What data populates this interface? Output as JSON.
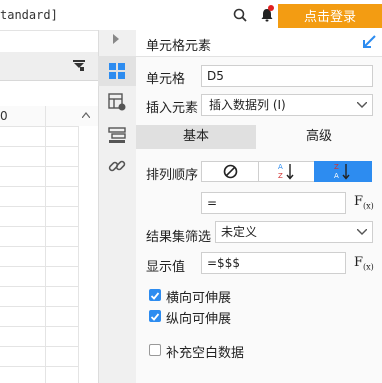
{
  "topbar": {
    "filename": "tandard]",
    "login_label": "点击登录"
  },
  "sheet": {
    "cell_value": "0"
  },
  "panel": {
    "title": "单元格元素",
    "cell_label": "单元格",
    "cell_value": "D5",
    "insert_label": "插入元素",
    "insert_value": "插入数据列 (I)",
    "tabs": [
      "基本",
      "高级"
    ],
    "sort_label": "排列顺序",
    "formula_value": "=",
    "filter_label": "结果集筛选",
    "filter_value": "未定义",
    "display_label": "显示值",
    "display_value": "=$$$",
    "fx_label": "F",
    "fx_sub": "(x)",
    "checkbox_h": "横向可伸展",
    "checkbox_v": "纵向可伸展",
    "checkbox_fill": "补充空白数据",
    "checked": [
      true,
      true,
      false
    ]
  },
  "colors": {
    "accent": "#2d8cf0",
    "login": "#f39c12"
  }
}
